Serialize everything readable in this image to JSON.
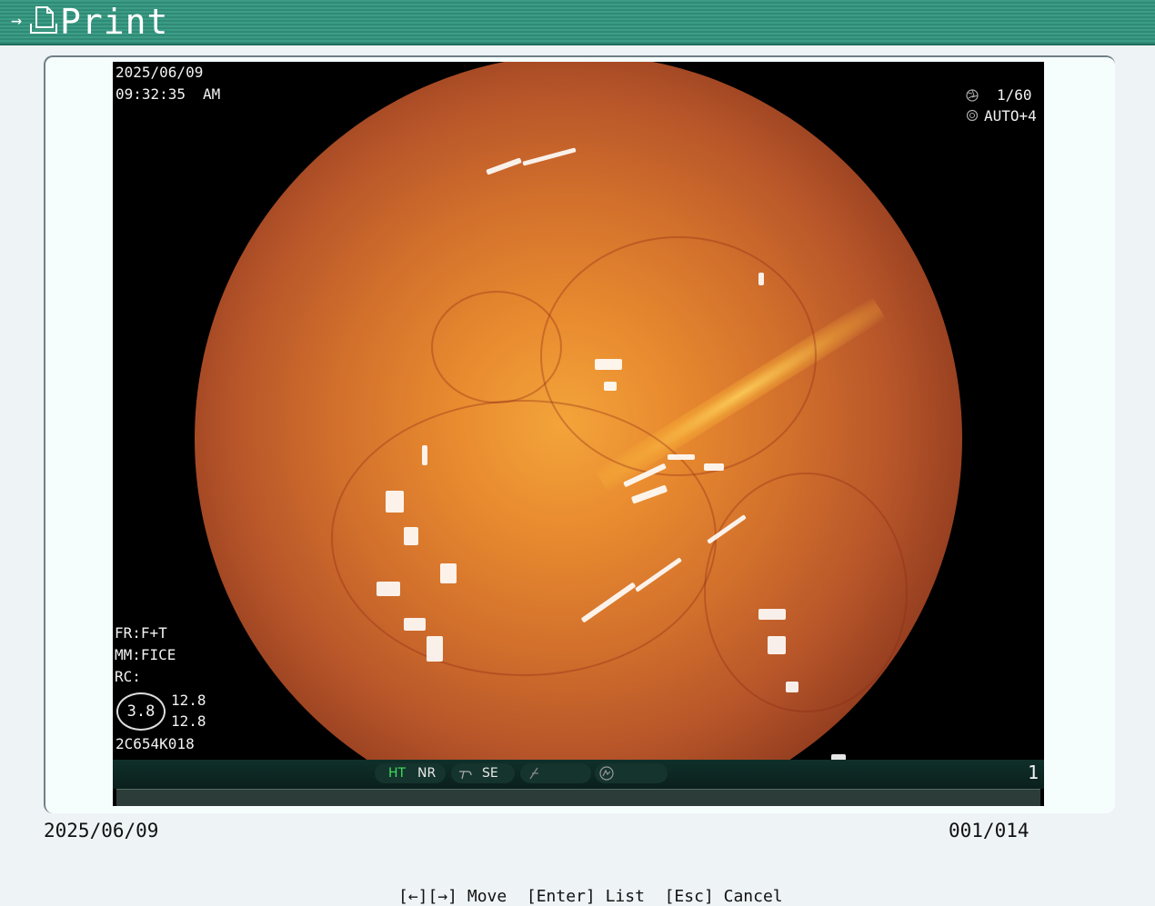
{
  "titlebar": {
    "arrow": "→",
    "title": "Print",
    "icon": "document-icon"
  },
  "image_overlay": {
    "date": "2025/06/09",
    "time": "09:32:35",
    "ampm": "AM",
    "shutter": "1/60",
    "shutter_icon": "shutter-icon",
    "iris": "AUTO+4",
    "iris_icon": "iris-icon",
    "fr": "FR:F+T",
    "mm": "MM:FICE",
    "rc": "RC:",
    "ratio": "3.8",
    "value1": "12.8",
    "value2": "12.8",
    "scope_id": "2C654K018",
    "status": {
      "ht": "HT",
      "nr": "NR",
      "se": "SE",
      "ht_color": "#3ee05a"
    },
    "screen_number": "1"
  },
  "footer": {
    "date": "2025/06/09",
    "counter": "001/014",
    "hint": "[←][→] Move  [Enter] List  [Esc] Cancel"
  }
}
